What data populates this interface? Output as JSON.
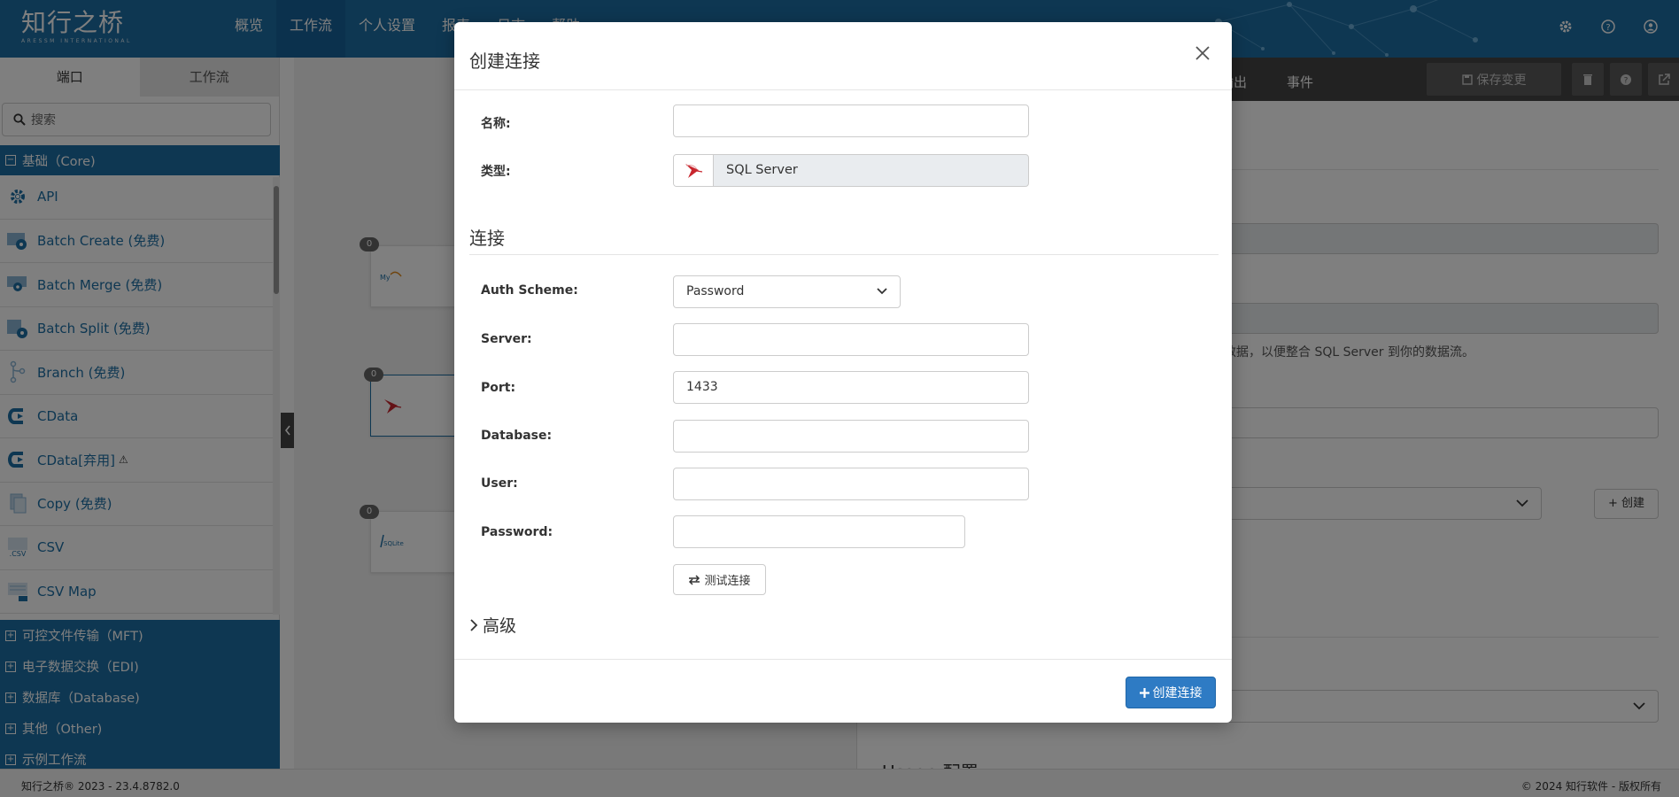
{
  "app": {
    "logo_text": "知行之桥",
    "logo_sub": "ARESSM INTERNATIONAL"
  },
  "nav": [
    "概览",
    "工作流",
    "个人设置",
    "报表",
    "日志",
    "帮助"
  ],
  "nav_active": 1,
  "sidebar": {
    "tabs": [
      "端口",
      "工作流"
    ],
    "search_placeholder": "搜索",
    "core_group": "基础（Core)",
    "items": [
      {
        "label": "API",
        "icon": "gear-icon"
      },
      {
        "label": "Batch Create (免费)",
        "icon": "batch-create-icon"
      },
      {
        "label": "Batch Merge (免费)",
        "icon": "batch-merge-icon"
      },
      {
        "label": "Batch Split (免费)",
        "icon": "batch-split-icon"
      },
      {
        "label": "Branch (免费)",
        "icon": "branch-icon"
      },
      {
        "label": "CData",
        "icon": "cdata-icon"
      },
      {
        "label": "CData[弃用]",
        "icon": "cdata-icon",
        "warning": true
      },
      {
        "label": "Copy (免费)",
        "icon": "copy-icon"
      },
      {
        "label": "CSV",
        "icon": "csv-icon"
      },
      {
        "label": "CSV Map",
        "icon": "csv-map-icon"
      }
    ],
    "other_groups": [
      "可控文件传输（MFT)",
      "电子数据交换（EDI)",
      "数据库（Database)",
      "其他（Other)",
      "示例工作流"
    ]
  },
  "canvas": {
    "badges": [
      "0",
      "0",
      "0"
    ]
  },
  "right_panel": {
    "tabs": [
      "输出",
      "事件"
    ],
    "save_label": "保存变更",
    "desc_fragment": "取数据，以便整合 SQL Server 到你的数据流。",
    "create_label": "+ 创建",
    "section_fragment": "Usage 配置"
  },
  "footer": {
    "left": "知行之桥® 2023 - 23.4.8782.0",
    "right": "© 2024 知行软件 - 版权所有"
  },
  "modal": {
    "title": "创建连接",
    "name_label": "名称:",
    "name_value": "",
    "type_label": "类型:",
    "type_value": "SQL Server",
    "section_connection": "连接",
    "auth_label": "Auth Scheme:",
    "auth_value": "Password",
    "server_label": "Server:",
    "server_value": "",
    "port_label": "Port:",
    "port_value": "1433",
    "database_label": "Database:",
    "database_value": "",
    "user_label": "User:",
    "user_value": "",
    "password_label": "Password:",
    "password_value": "",
    "test_label": "测试连接",
    "advanced_label": "高级",
    "create_label": "创建连接"
  },
  "colors": {
    "brand": "#1c6ea4",
    "primary_button": "#2e7bc4",
    "toolbar": "#444444"
  }
}
